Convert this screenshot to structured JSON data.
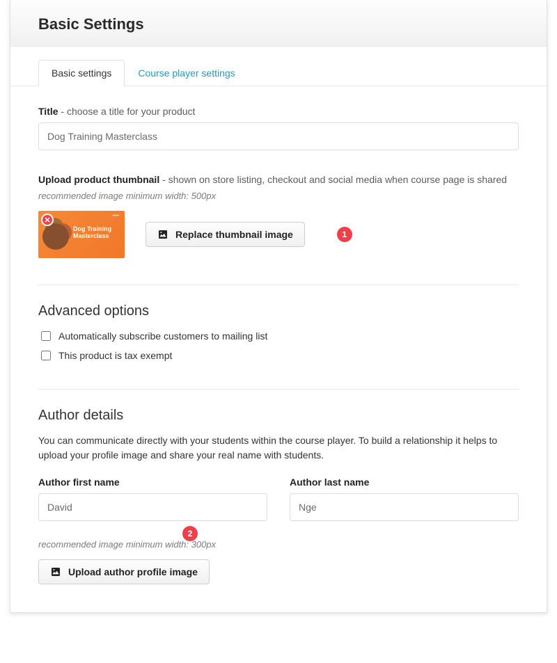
{
  "header": {
    "title": "Basic Settings"
  },
  "tabs": {
    "basic": "Basic settings",
    "player": "Course player settings"
  },
  "title_field": {
    "label_strong": "Title",
    "label_hint": " - choose a title for your product",
    "value": "Dog Training Masterclass"
  },
  "thumbnail": {
    "label_strong": "Upload product thumbnail",
    "label_hint": " - shown on store listing, checkout and social media when course page is shared",
    "reco": "recommended image minimum width: 500px",
    "preview_title": "Dog Training Masterclass",
    "replace_button": "Replace thumbnail image"
  },
  "annotations": {
    "one": "1",
    "two": "2"
  },
  "advanced": {
    "heading": "Advanced options",
    "opt_subscribe": "Automatically subscribe customers to mailing list",
    "opt_tax": "This product is tax exempt"
  },
  "author": {
    "heading": "Author details",
    "desc": "You can communicate directly with your students within the course player. To build a relationship it helps to upload your profile image and share your real name with students.",
    "first_label": "Author first name",
    "first_value": "David",
    "last_label": "Author last name",
    "last_value": "Nge",
    "reco": "recommended image minimum width: 300px",
    "upload_button": "Upload author profile image"
  }
}
